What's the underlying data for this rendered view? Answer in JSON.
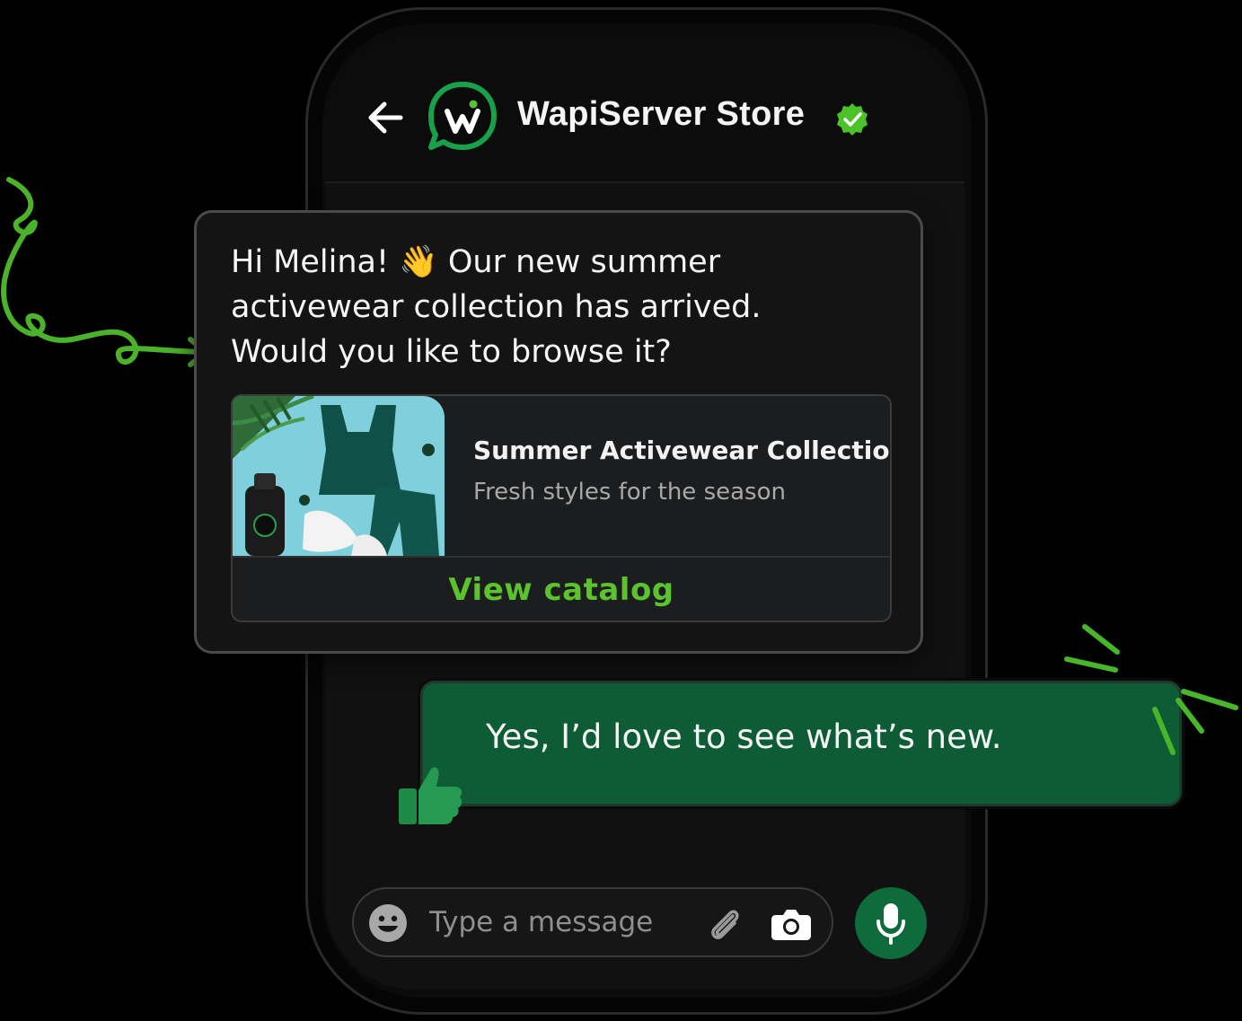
{
  "colors": {
    "accent": "#5cc22e",
    "brand_green": "#0e6b3c",
    "bubble_green": "#0d5c36",
    "background": "#000000"
  },
  "header": {
    "store_name": "WapiServer Store",
    "back_icon": "arrow-left-icon",
    "verified_icon": "verified-check-icon",
    "logo_icon": "wapiserver-logo"
  },
  "incoming_message": {
    "text": "Hi Melina! 👋 Our new summer\nactivewear collection has arrived.\nWould you like to browse it?",
    "catalog": {
      "title": "Summer Activewear Collection",
      "subtitle": "Fresh styles for the season",
      "action_label": "View catalog"
    }
  },
  "outgoing_message": {
    "text": "Yes, I’d love to see what’s new."
  },
  "composer": {
    "placeholder": "Type a message",
    "emoji_icon": "emoji-icon",
    "attach_icon": "paperclip-icon",
    "camera_icon": "camera-icon",
    "mic_icon": "microphone-icon"
  }
}
